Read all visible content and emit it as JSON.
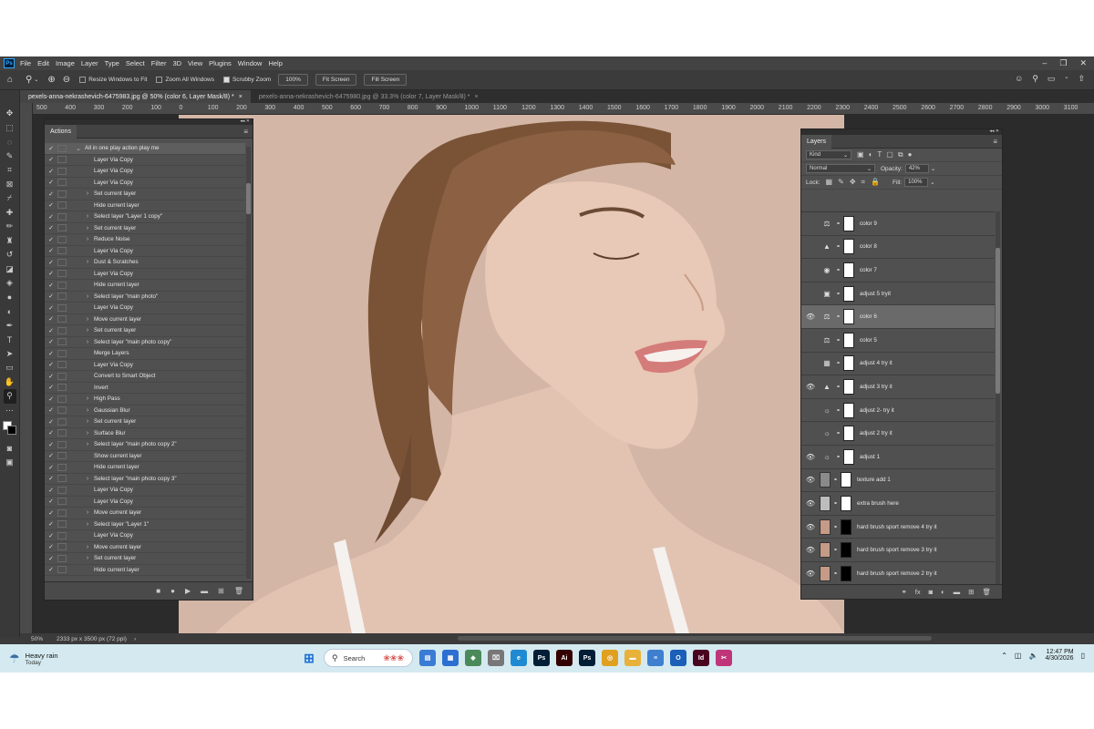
{
  "menubar": {
    "logo": "Ps",
    "items": [
      "File",
      "Edit",
      "Image",
      "Layer",
      "Type",
      "Select",
      "Filter",
      "3D",
      "View",
      "Plugins",
      "Window",
      "Help"
    ]
  },
  "options": {
    "resize_windows": "Resize Windows to Fit",
    "zoom_all": "Zoom All Windows",
    "scrubby": "Scrubby Zoom",
    "zoom_value": "100%",
    "fit_screen": "Fit Screen",
    "fill_screen": "Fill Screen"
  },
  "tabs": [
    {
      "label": "pexels-anna-nekrashevich-6475983.jpg @ 50% (color 6, Layer Mask/8) *"
    },
    {
      "label": "pexels-anna-nekrashevich-6475980.jpg @ 33.3% (color 7, Layer Mask/8) *"
    }
  ],
  "ruler": {
    "ticks": [
      "500",
      "400",
      "300",
      "200",
      "100",
      "0",
      "100",
      "200",
      "300",
      "400",
      "500",
      "600",
      "700",
      "800",
      "900",
      "1000",
      "1100",
      "1200",
      "1300",
      "1400",
      "1500",
      "1600",
      "1700",
      "1800",
      "1900",
      "2000",
      "2100",
      "2200",
      "2300",
      "2400",
      "2500",
      "2600",
      "2700",
      "2800",
      "2900",
      "3000",
      "3100"
    ]
  },
  "status": {
    "zoom": "50%",
    "doc_size": "2333 px x 3500 px (72 ppi)"
  },
  "actions": {
    "title": "Actions",
    "items": [
      {
        "label": "All in one play action play me",
        "set": true,
        "expand": "⌄"
      },
      {
        "label": "Layer Via Copy",
        "expand": ""
      },
      {
        "label": "Layer Via Copy",
        "expand": ""
      },
      {
        "label": "Layer Via Copy",
        "expand": ""
      },
      {
        "label": "Set current layer",
        "expand": "›"
      },
      {
        "label": "Hide current layer",
        "expand": ""
      },
      {
        "label": "Select layer \"Layer 1 copy\"",
        "expand": "›"
      },
      {
        "label": "Set current layer",
        "expand": "›"
      },
      {
        "label": "Reduce Noise",
        "expand": "›"
      },
      {
        "label": "Layer Via Copy",
        "expand": ""
      },
      {
        "label": "Dust & Scratches",
        "expand": "›"
      },
      {
        "label": "Layer Via Copy",
        "expand": ""
      },
      {
        "label": "Hide current layer",
        "expand": ""
      },
      {
        "label": "Select layer \"main photo\"",
        "expand": "›"
      },
      {
        "label": "Layer Via Copy",
        "expand": ""
      },
      {
        "label": "Move current layer",
        "expand": "›"
      },
      {
        "label": "Set current layer",
        "expand": "›"
      },
      {
        "label": "Select layer \"main photo copy\"",
        "expand": "›"
      },
      {
        "label": "Merge Layers",
        "expand": ""
      },
      {
        "label": "Layer Via Copy",
        "expand": ""
      },
      {
        "label": "Convert to Smart Object",
        "expand": ""
      },
      {
        "label": "Invert",
        "expand": ""
      },
      {
        "label": "High Pass",
        "expand": "›"
      },
      {
        "label": "Gaussian Blur",
        "expand": "›"
      },
      {
        "label": "Set current layer",
        "expand": "›"
      },
      {
        "label": "Surface Blur",
        "expand": "›"
      },
      {
        "label": "Select layer \"main photo copy 2\"",
        "expand": "›"
      },
      {
        "label": "Show current layer",
        "expand": ""
      },
      {
        "label": "Hide current layer",
        "expand": ""
      },
      {
        "label": "Select layer \"main photo copy 3\"",
        "expand": "›"
      },
      {
        "label": "Layer Via Copy",
        "expand": ""
      },
      {
        "label": "Layer Via Copy",
        "expand": ""
      },
      {
        "label": "Move current layer",
        "expand": "›"
      },
      {
        "label": "Select layer \"Layer 1\"",
        "expand": "›"
      },
      {
        "label": "Layer Via Copy",
        "expand": ""
      },
      {
        "label": "Move current layer",
        "expand": "›"
      },
      {
        "label": "Set current layer",
        "expand": "›"
      },
      {
        "label": "Hide current layer",
        "expand": ""
      }
    ]
  },
  "layers": {
    "title": "Layers",
    "kind": "Kind",
    "blend_mode": "Normal",
    "opacity_label": "Opacity:",
    "opacity_value": "42%",
    "lock_label": "Lock:",
    "fill_label": "Fill:",
    "fill_value": "100%",
    "items": [
      {
        "name": "color 9",
        "visible": false,
        "icon": "⚖",
        "thumb": "#ffffff",
        "mask": "#ffffff",
        "selected": false
      },
      {
        "name": "color 8",
        "visible": false,
        "icon": "▲",
        "thumb": "#ffffff",
        "mask": "#ffffff",
        "selected": false
      },
      {
        "name": "color 7",
        "visible": false,
        "icon": "◉",
        "thumb": "#ffffff",
        "mask": "#ffffff",
        "selected": false
      },
      {
        "name": "adjust 5 tryit",
        "visible": false,
        "icon": "▣",
        "thumb": "#ffffff",
        "mask": "#ffffff",
        "selected": false
      },
      {
        "name": "color 6",
        "visible": true,
        "icon": "⚖",
        "thumb": "#ffffff",
        "mask": "#ffffff",
        "selected": true
      },
      {
        "name": "color 5",
        "visible": false,
        "icon": "⚖",
        "thumb": "#ffffff",
        "mask": "#ffffff",
        "selected": false
      },
      {
        "name": "adjust 4 try it",
        "visible": false,
        "icon": "▦",
        "thumb": "#ffffff",
        "mask": "#ffffff",
        "selected": false
      },
      {
        "name": "adjust 3 try it",
        "visible": true,
        "icon": "▲",
        "thumb": "#ffffff",
        "mask": "#ffffff",
        "selected": false
      },
      {
        "name": "adjust 2- try it",
        "visible": false,
        "icon": "☼",
        "thumb": "#ffffff",
        "mask": "#ffffff",
        "selected": false
      },
      {
        "name": "adjust 2 try it",
        "visible": false,
        "icon": "☼",
        "thumb": "#ffffff",
        "mask": "#ffffff",
        "selected": false
      },
      {
        "name": "adjust 1",
        "visible": true,
        "icon": "☼",
        "thumb": "#ffffff",
        "mask": "#ffffff",
        "selected": false
      },
      {
        "name": "texture add 1",
        "visible": true,
        "icon": "",
        "thumb": "#8a8a8a",
        "mask": "#ffffff",
        "selected": false
      },
      {
        "name": "extra brush here",
        "visible": true,
        "icon": "",
        "thumb": "#bdbdbd",
        "mask": "#ffffff",
        "selected": false
      },
      {
        "name": "hard brush sport remove 4 try it",
        "visible": true,
        "icon": "",
        "thumb": "#c59a86",
        "mask": "#000000",
        "selected": false
      },
      {
        "name": "hard brush sport remove 3 try it",
        "visible": true,
        "icon": "",
        "thumb": "#c59a86",
        "mask": "#000000",
        "selected": false
      },
      {
        "name": "hard brush sport remove 2 try it",
        "visible": true,
        "icon": "",
        "thumb": "#c59a86",
        "mask": "#000000",
        "selected": false
      }
    ]
  },
  "taskbar": {
    "weather_title": "Heavy rain",
    "weather_sub": "Today",
    "search_placeholder": "Search",
    "time": "12:47 PM",
    "date": "4/30/2026",
    "apps": [
      {
        "name": "file-explorer-icon",
        "color": "#3a7bd5",
        "glyph": "▤"
      },
      {
        "name": "store-icon",
        "color": "#2c6fd1",
        "glyph": "▦"
      },
      {
        "name": "news-icon",
        "color": "#4a8a5a",
        "glyph": "◈"
      },
      {
        "name": "usb-icon",
        "color": "#777777",
        "glyph": "⌧"
      },
      {
        "name": "edge-icon",
        "color": "#1f8ad2",
        "glyph": "e"
      },
      {
        "name": "photoshop-icon-1",
        "color": "#001e36",
        "glyph": "Ps"
      },
      {
        "name": "illustrator-icon",
        "color": "#330000",
        "glyph": "Ai"
      },
      {
        "name": "photoshop-icon-2",
        "color": "#001e36",
        "glyph": "Ps"
      },
      {
        "name": "chrome-icon",
        "color": "#e0a020",
        "glyph": "◎"
      },
      {
        "name": "folder-icon",
        "color": "#e8b23a",
        "glyph": "▬"
      },
      {
        "name": "notepad-icon",
        "color": "#3f7fd0",
        "glyph": "≡"
      },
      {
        "name": "outlook-icon",
        "color": "#1b5fb8",
        "glyph": "O"
      },
      {
        "name": "indesign-icon",
        "color": "#49021f",
        "glyph": "Id"
      },
      {
        "name": "snipping-icon",
        "color": "#c0357a",
        "glyph": "✂"
      }
    ]
  }
}
